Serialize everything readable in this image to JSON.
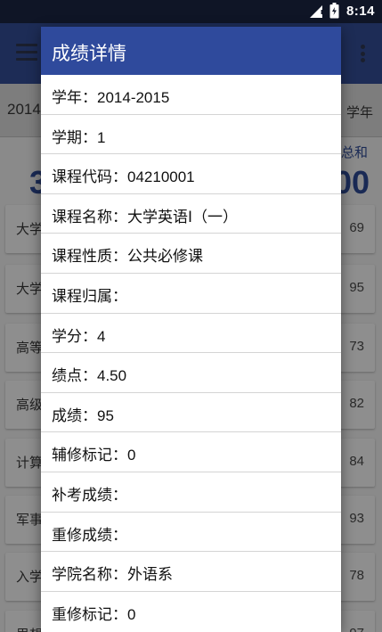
{
  "status_bar": {
    "time": "8:14",
    "icons": [
      "signal-icon",
      "battery-icon"
    ]
  },
  "app_bar": {
    "icons": [
      "menu-icon",
      "overflow-menu-icon"
    ]
  },
  "filter": {
    "year_partial": "2014",
    "right_partial": "学年"
  },
  "summary": {
    "left_partial": "3",
    "label_partial": "总和",
    "right_partial": "00"
  },
  "courses": [
    {
      "name_partial": "大学",
      "score": "69"
    },
    {
      "name_partial": "大学",
      "score": "95"
    },
    {
      "name_partial": "高等",
      "score": "73"
    },
    {
      "name_partial": "高级",
      "score": "82"
    },
    {
      "name_partial": "计算",
      "score": "84"
    },
    {
      "name_partial": "军事",
      "score": "93"
    },
    {
      "name_partial": "入学",
      "score": "78"
    },
    {
      "name_partial": "思想",
      "score": "97"
    }
  ],
  "dialog": {
    "title": "成绩详情",
    "rows": [
      {
        "label": "学年：",
        "value": "2014-2015"
      },
      {
        "label": "学期：",
        "value": "1"
      },
      {
        "label": "课程代码：",
        "value": "04210001"
      },
      {
        "label": "课程名称：",
        "value": "大学英语I（一）"
      },
      {
        "label": "课程性质：",
        "value": "公共必修课"
      },
      {
        "label": "课程归属：",
        "value": ""
      },
      {
        "label": "学分：",
        "value": "4"
      },
      {
        "label": "绩点：",
        "value": "4.50"
      },
      {
        "label": "成绩：",
        "value": "95"
      },
      {
        "label": "辅修标记：",
        "value": "0"
      },
      {
        "label": "补考成绩：",
        "value": ""
      },
      {
        "label": "重修成绩：",
        "value": ""
      },
      {
        "label": "学院名称：",
        "value": "外语系"
      },
      {
        "label": "重修标记：",
        "value": "0"
      }
    ]
  }
}
